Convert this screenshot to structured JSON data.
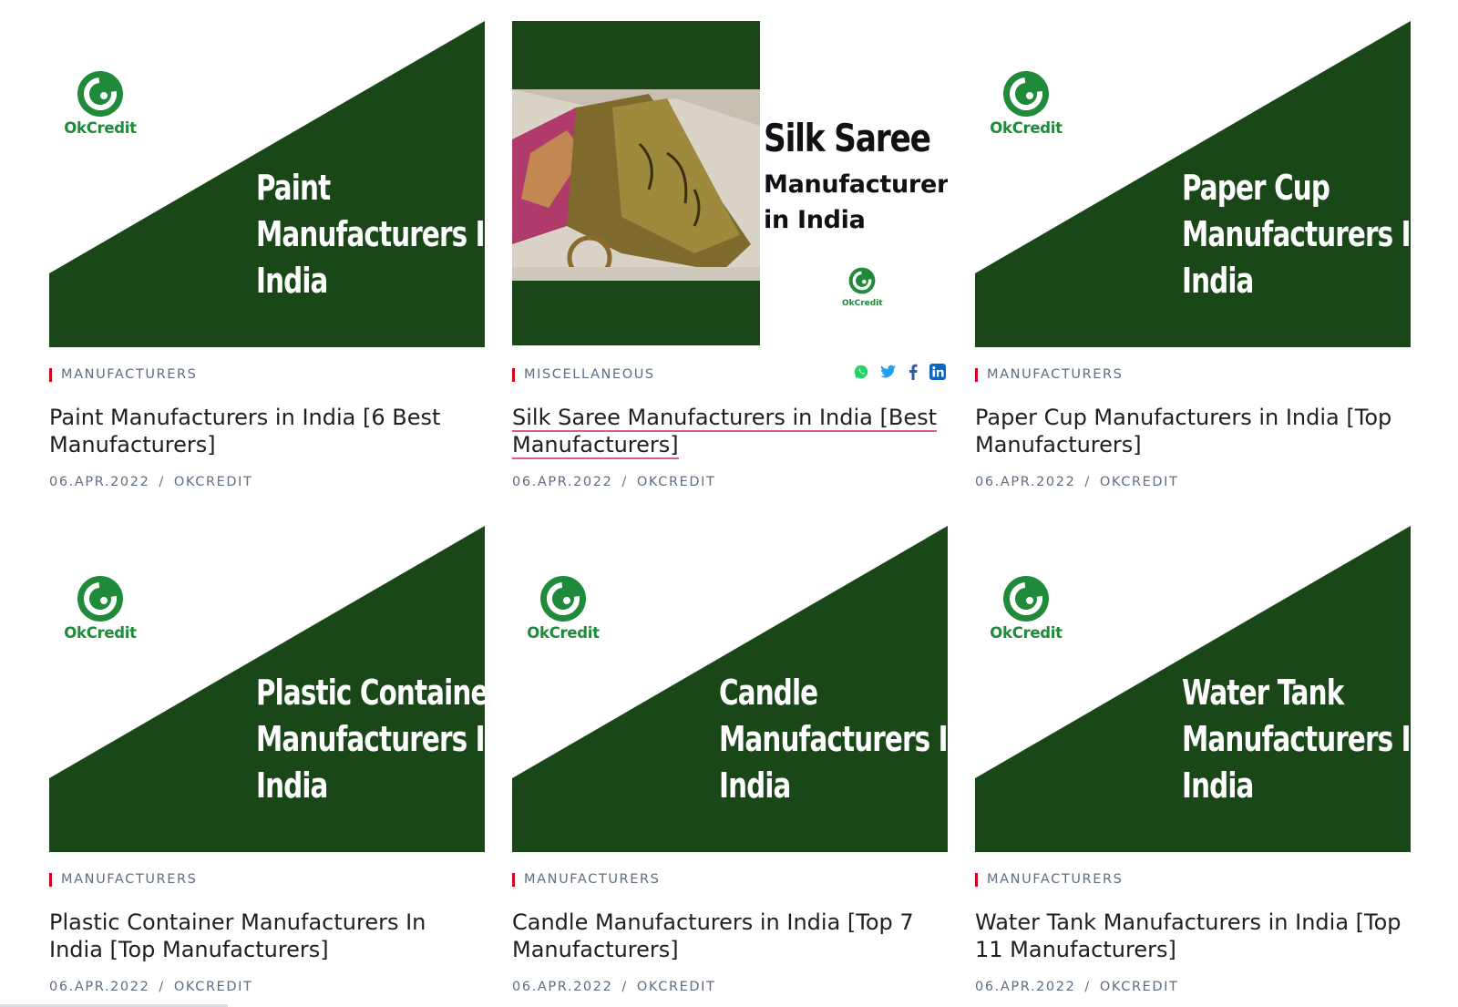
{
  "colors": {
    "thumb_green": "#1a4717",
    "logo_green": "#1f8a3a",
    "category_bar": "#d1061e",
    "meta_text": "#5d6e82",
    "title_text": "#1f1f1f"
  },
  "share_icons": [
    "whatsapp-icon",
    "twitter-icon",
    "facebook-icon",
    "linkedin-icon"
  ],
  "posts": [
    {
      "logo_text": "OkCredit",
      "thumb_lines": [
        "Paint",
        "Manufacturers In",
        "India"
      ],
      "category": "MANUFACTURERS",
      "title": "Paint Manufacturers in India [6 Best Manufacturers]",
      "date": "06.APR.2022",
      "author": "OKCREDIT"
    },
    {
      "thumb_heading": "Silk Saree",
      "thumb_sub1": "Manufacturers",
      "thumb_sub2": "in India",
      "logo_text": "OkCredit",
      "category": "MISCELLANEOUS",
      "title": "Silk Saree Manufacturers in India [Best Manufacturers]",
      "date": "06.APR.2022",
      "author": "OKCREDIT"
    },
    {
      "logo_text": "OkCredit",
      "thumb_lines": [
        "Paper Cup",
        "Manufacturers In",
        "India"
      ],
      "category": "MANUFACTURERS",
      "title": "Paper Cup Manufacturers in India [Top Manufacturers]",
      "date": "06.APR.2022",
      "author": "OKCREDIT"
    },
    {
      "logo_text": "OkCredit",
      "thumb_lines": [
        "Plastic Container",
        "Manufacturers In",
        "India"
      ],
      "category": "MANUFACTURERS",
      "title": "Plastic Container Manufacturers In India [Top Manufacturers]",
      "date": "06.APR.2022",
      "author": "OKCREDIT"
    },
    {
      "logo_text": "OkCredit",
      "thumb_lines": [
        "Candle",
        "Manufacturers In",
        "India"
      ],
      "category": "MANUFACTURERS",
      "title": "Candle Manufacturers in India [Top 7 Manufacturers]",
      "date": "06.APR.2022",
      "author": "OKCREDIT"
    },
    {
      "logo_text": "OkCredit",
      "thumb_lines": [
        "Water Tank",
        "Manufacturers In",
        "India"
      ],
      "category": "MANUFACTURERS",
      "title": "Water Tank Manufacturers in India [Top 11 Manufacturers]",
      "date": "06.APR.2022",
      "author": "OKCREDIT"
    }
  ]
}
